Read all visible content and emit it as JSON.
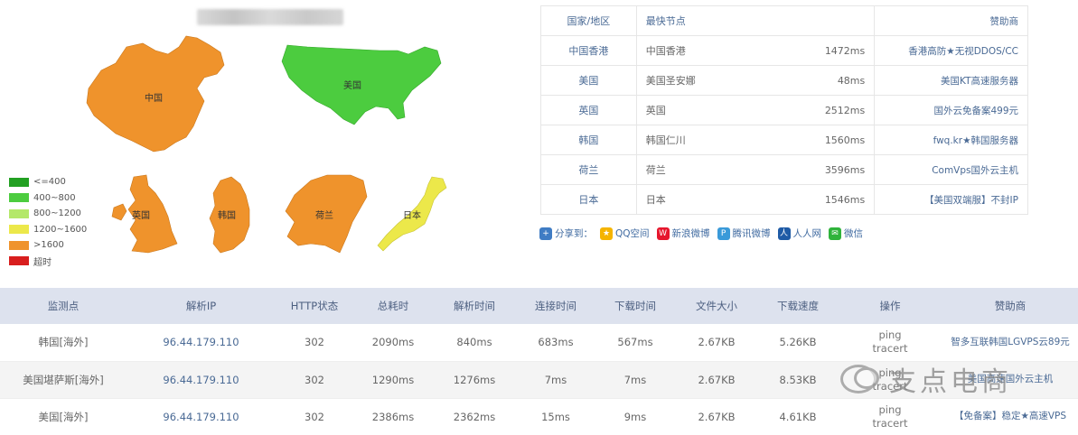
{
  "legend": [
    {
      "label": "<=400",
      "color": "#22a022"
    },
    {
      "label": "400~800",
      "color": "#4ccc3f"
    },
    {
      "label": "800~1200",
      "color": "#b4e86a"
    },
    {
      "label": "1200~1600",
      "color": "#ece84a"
    },
    {
      "label": ">1600",
      "color": "#ef932c"
    },
    {
      "label": "超时",
      "color": "#d81e1e"
    }
  ],
  "map_labels": {
    "china": "中国",
    "usa": "美国",
    "uk": "英国",
    "korea": "韩国",
    "netherlands": "荷兰",
    "japan": "日本"
  },
  "region_table": {
    "headers": {
      "country": "国家/地区",
      "node": "最快节点",
      "sponsor": "赞助商"
    },
    "rows": [
      {
        "country": "中国香港",
        "node": "中国香港",
        "time": "1472ms",
        "sponsor": "香港高防★无视DDOS/CC"
      },
      {
        "country": "美国",
        "node": "美国圣安娜",
        "time": "48ms",
        "sponsor": "美国KT高速服务器"
      },
      {
        "country": "英国",
        "node": "英国",
        "time": "2512ms",
        "sponsor": "国外云免备案499元"
      },
      {
        "country": "韩国",
        "node": "韩国仁川",
        "time": "1560ms",
        "sponsor": "fwq.kr★韩国服务器"
      },
      {
        "country": "荷兰",
        "node": "荷兰",
        "time": "3596ms",
        "sponsor": "ComVps国外云主机"
      },
      {
        "country": "日本",
        "node": "日本",
        "time": "1546ms",
        "sponsor": "【美国双端服】不封IP"
      }
    ]
  },
  "share": {
    "label": "分享到：",
    "items": [
      {
        "name": "QQ空间",
        "icon": "qzone-icon"
      },
      {
        "name": "新浪微博",
        "icon": "weibo-icon"
      },
      {
        "name": "腾讯微博",
        "icon": "tencent-weibo-icon"
      },
      {
        "name": "人人网",
        "icon": "renren-icon"
      },
      {
        "name": "微信",
        "icon": "wechat-icon"
      }
    ]
  },
  "main_table": {
    "headers": [
      "监测点",
      "解析IP",
      "HTTP状态",
      "总耗时",
      "解析时间",
      "连接时间",
      "下载时间",
      "文件大小",
      "下载速度",
      "操作",
      "赞助商"
    ],
    "rows": [
      {
        "point": "韩国[海外]",
        "ip": "96.44.179.110",
        "status": "302",
        "total": "2090ms",
        "resolve": "840ms",
        "connect": "683ms",
        "download": "567ms",
        "size": "2.67KB",
        "speed": "5.26KB",
        "op1": "ping",
        "op2": "tracert",
        "sponsor": "智多互联韩国LGVPS云89元"
      },
      {
        "point": "美国堪萨斯[海外]",
        "ip": "96.44.179.110",
        "status": "302",
        "total": "1290ms",
        "resolve": "1276ms",
        "connect": "7ms",
        "download": "7ms",
        "size": "2.67KB",
        "speed": "8.53KB",
        "op1": "ping",
        "op2": "tracert",
        "sponsor": "美国高速国外云主机"
      },
      {
        "point": "美国[海外]",
        "ip": "96.44.179.110",
        "status": "302",
        "total": "2386ms",
        "resolve": "2362ms",
        "connect": "15ms",
        "download": "9ms",
        "size": "2.67KB",
        "speed": "4.61KB",
        "op1": "ping",
        "op2": "tracert",
        "sponsor": "【免备案】稳定★高速VPS"
      }
    ]
  },
  "watermark": {
    "text": "支点电商"
  },
  "colors": {
    "orange": "#ef932c",
    "green": "#4ccc3f",
    "yellow": "#ece84a",
    "header_bg": "#dde2ee"
  }
}
